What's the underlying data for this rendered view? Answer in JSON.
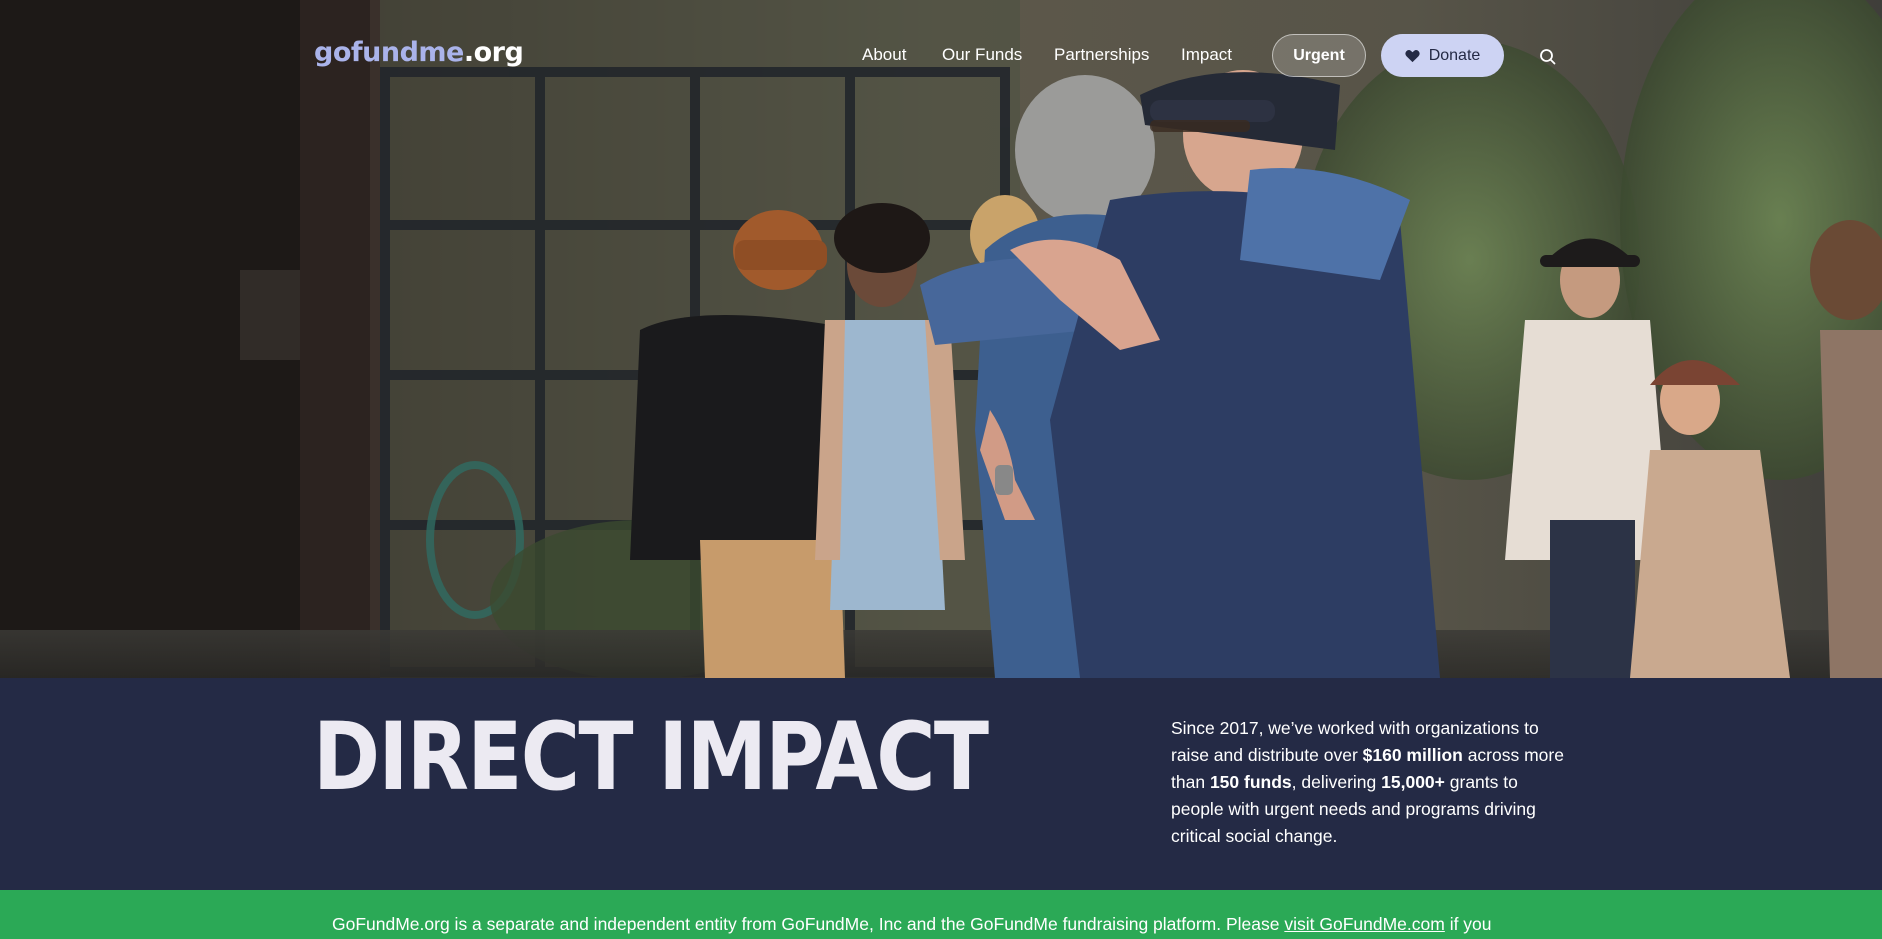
{
  "nav": {
    "logo_part1": "gofundme",
    "logo_part2": ".org",
    "links": [
      "About",
      "Our Funds",
      "Partnerships",
      "Impact"
    ],
    "urgent_label": "Urgent",
    "donate_label": "Donate"
  },
  "icons": {
    "search": "search-icon",
    "heart": "heart-icon"
  },
  "hero": {
    "image": "photo-two-people-hugging-in-courtyard"
  },
  "impact": {
    "title": "DIRECT IMPACT",
    "blurb": {
      "p1": "Since 2017, we’ve worked with organizations to raise and distribute over ",
      "amount": "$160 million",
      "p2": " across more than ",
      "funds": "150 funds",
      "p3": ", delivering ",
      "grants": "15,000+",
      "p4": " grants to people with urgent needs and programs driving critical social change."
    }
  },
  "notice": {
    "text_before": "GoFundMe.org is a separate and independent entity from GoFundMe, Inc and the GoFundMe fundraising platform. Please ",
    "link": "visit GoFundMe.com",
    "text_after": " if you"
  },
  "colors": {
    "navy": "#242a45",
    "lavender": "#cdd3f3",
    "green": "#2ba956",
    "logo_accent": "#aab3ea"
  }
}
